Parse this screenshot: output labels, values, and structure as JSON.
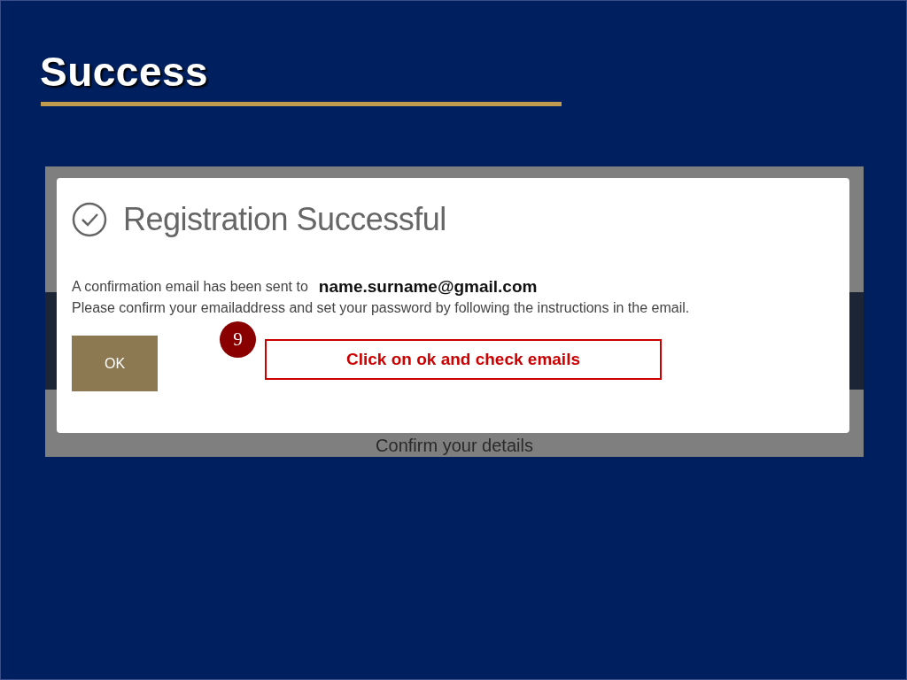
{
  "slide": {
    "title": "Success"
  },
  "screenshot": {
    "background_text": "Confirm your details",
    "dialog": {
      "title": "Registration Successful",
      "message": "A confirmation email has been sent to",
      "email": "name.surname@gmail.com",
      "instructions": "Please confirm your emailaddress and set your password by following the instructions in the email.",
      "button": "OK"
    },
    "annotation": {
      "step": "9",
      "callout": "Click on ok and check emails"
    }
  }
}
